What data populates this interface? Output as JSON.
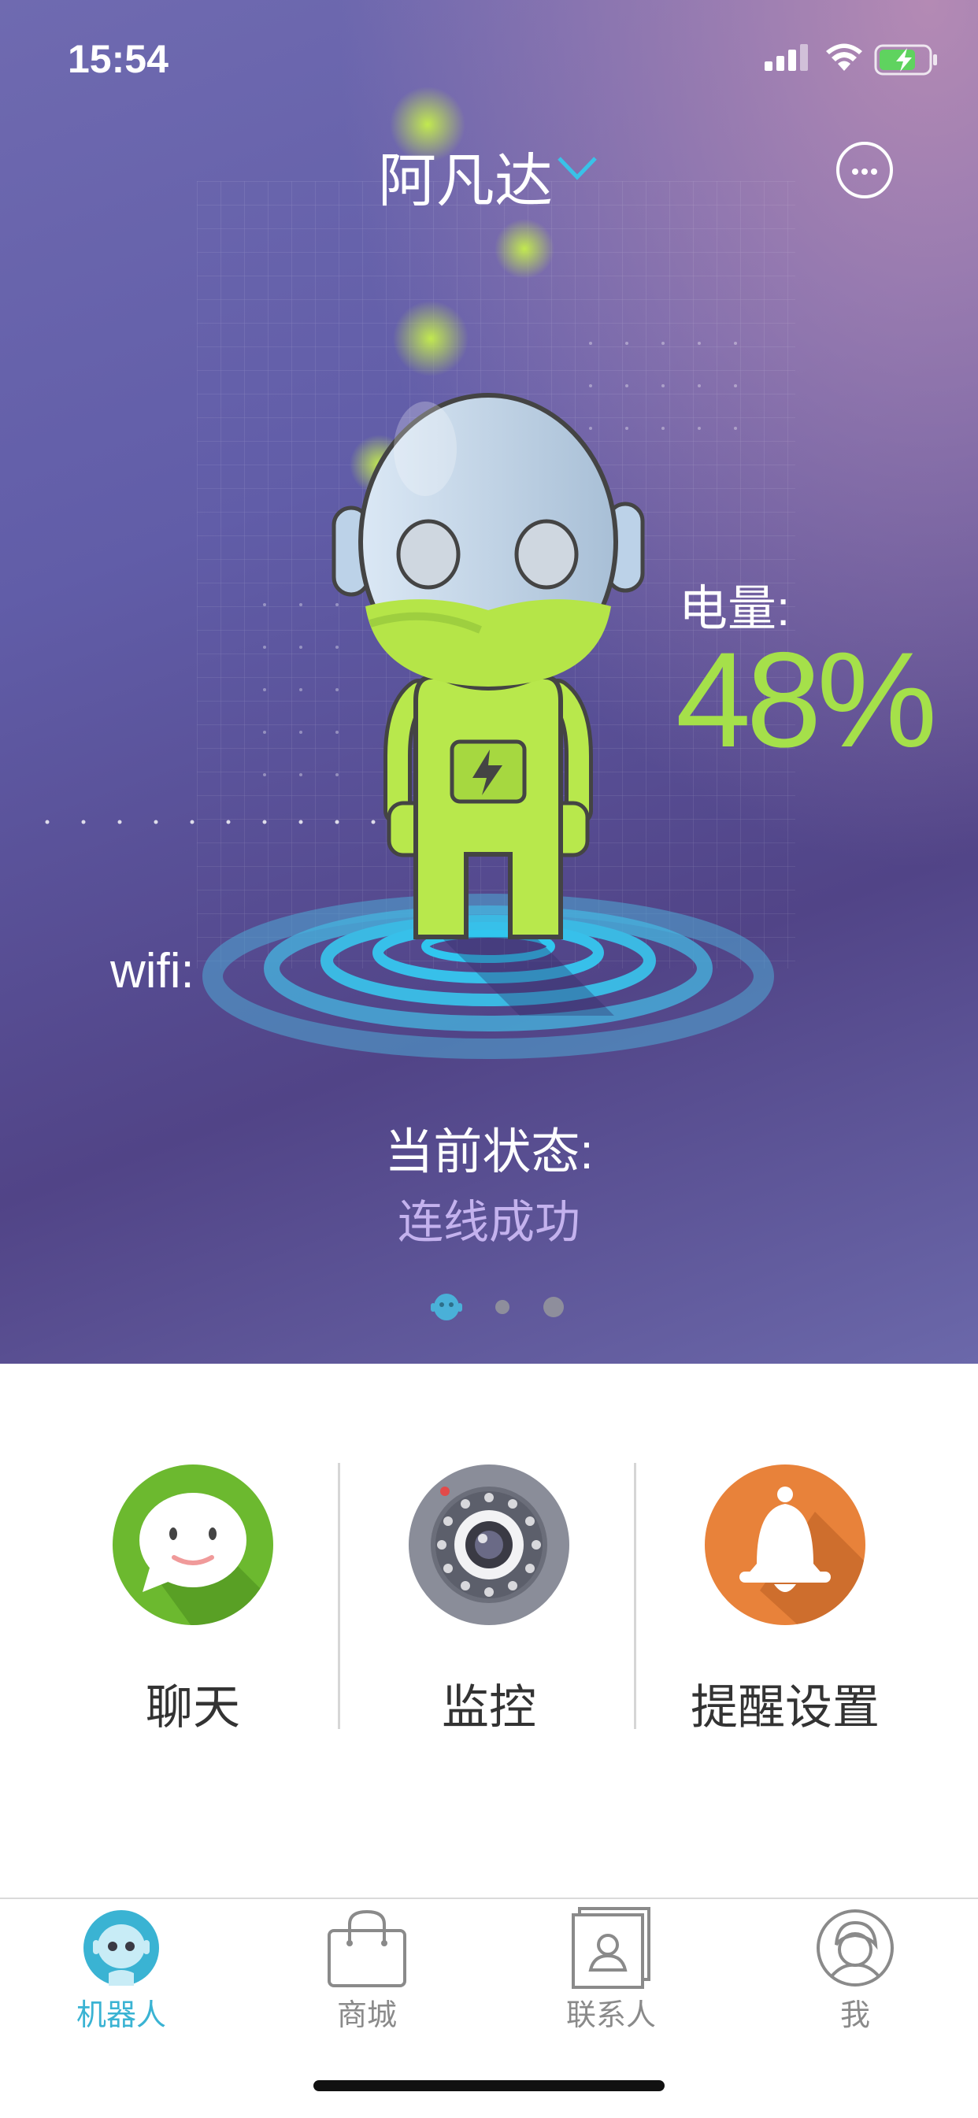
{
  "statusbar": {
    "time": "15:54",
    "battery_charging": true
  },
  "header": {
    "title": "阿凡达"
  },
  "device": {
    "battery_label": "电量:",
    "battery_value": "48%",
    "battery_percent": 48,
    "wifi_label": "wifi:",
    "state_label": "当前状态:",
    "state_value": "连线成功"
  },
  "pager": {
    "count": 3,
    "active": 0
  },
  "functions": [
    {
      "label": "聊天",
      "icon": "chat-icon",
      "color": "#6cb92f"
    },
    {
      "label": "监控",
      "icon": "camera-icon",
      "color": "#8a8d99"
    },
    {
      "label": "提醒设置",
      "icon": "bell-icon",
      "color": "#e8823a"
    }
  ],
  "tabbar": {
    "items": [
      {
        "label": "机器人",
        "icon": "robot-icon",
        "active": true
      },
      {
        "label": "商城",
        "icon": "shopping-bag-icon",
        "active": false
      },
      {
        "label": "联系人",
        "icon": "contacts-icon",
        "active": false
      },
      {
        "label": "我",
        "icon": "profile-icon",
        "active": false
      }
    ]
  },
  "colors": {
    "accent": "#3ab3d3",
    "battery_green": "#a5e04a",
    "status_text": "#c4b2ee"
  }
}
